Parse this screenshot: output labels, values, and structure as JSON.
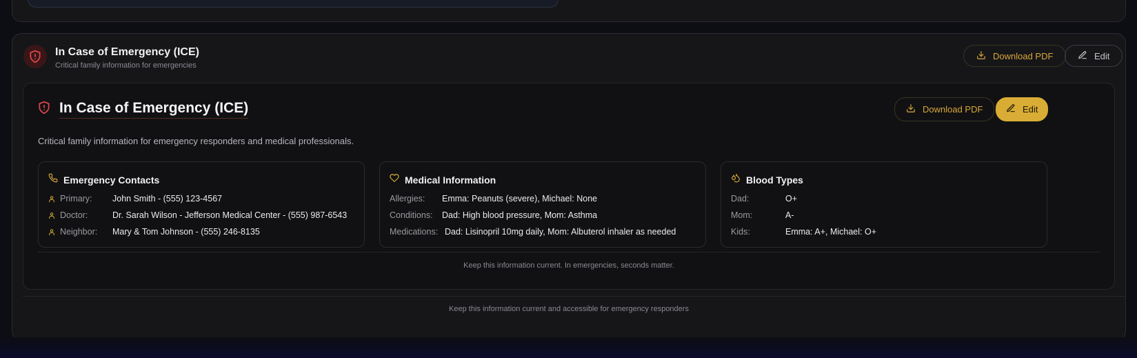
{
  "header": {
    "title": "In Case of Emergency (ICE)",
    "subtitle": "Critical family information for emergencies",
    "download_label": "Download PDF",
    "edit_label": "Edit"
  },
  "card": {
    "title": "In Case of Emergency (ICE)",
    "description": "Critical family information for emergency responders and medical professionals.",
    "download_label": "Download PDF",
    "edit_label": "Edit",
    "footer_note": "Keep this information current. In emergencies, seconds matter."
  },
  "emergency_contacts": {
    "title": "Emergency Contacts",
    "items": [
      {
        "label": "Primary:",
        "value": "John Smith - (555) 123-4567"
      },
      {
        "label": "Doctor:",
        "value": "Dr. Sarah Wilson - Jefferson Medical Center - (555) 987-6543"
      },
      {
        "label": "Neighbor:",
        "value": "Mary & Tom Johnson - (555) 246-8135"
      }
    ]
  },
  "medical_information": {
    "title": "Medical Information",
    "items": [
      {
        "label": "Allergies:",
        "value": "Emma: Peanuts (severe), Michael: None"
      },
      {
        "label": "Conditions:",
        "value": "Dad: High blood pressure, Mom: Asthma"
      },
      {
        "label": "Medications:",
        "value": "Dad: Lisinopril 10mg daily, Mom: Albuterol inhaler as needed"
      }
    ]
  },
  "blood_types": {
    "title": "Blood Types",
    "items": [
      {
        "label": "Dad:",
        "value": "O+"
      },
      {
        "label": "Mom:",
        "value": "A-"
      },
      {
        "label": "Kids:",
        "value": "Emma: A+, Michael: O+"
      }
    ]
  },
  "footer": {
    "note": "Keep this information current and accessible for emergency responders"
  },
  "colors": {
    "accent_gold": "#d9ad35",
    "danger_red": "#e5484d",
    "background": "#0d0d14"
  },
  "icons": {
    "header": "shield-alert-icon",
    "download": "download-icon",
    "edit": "pencil-icon",
    "contacts": "phone-icon",
    "medical": "heart-icon",
    "blood": "droplets-icon",
    "person": "user-icon"
  }
}
